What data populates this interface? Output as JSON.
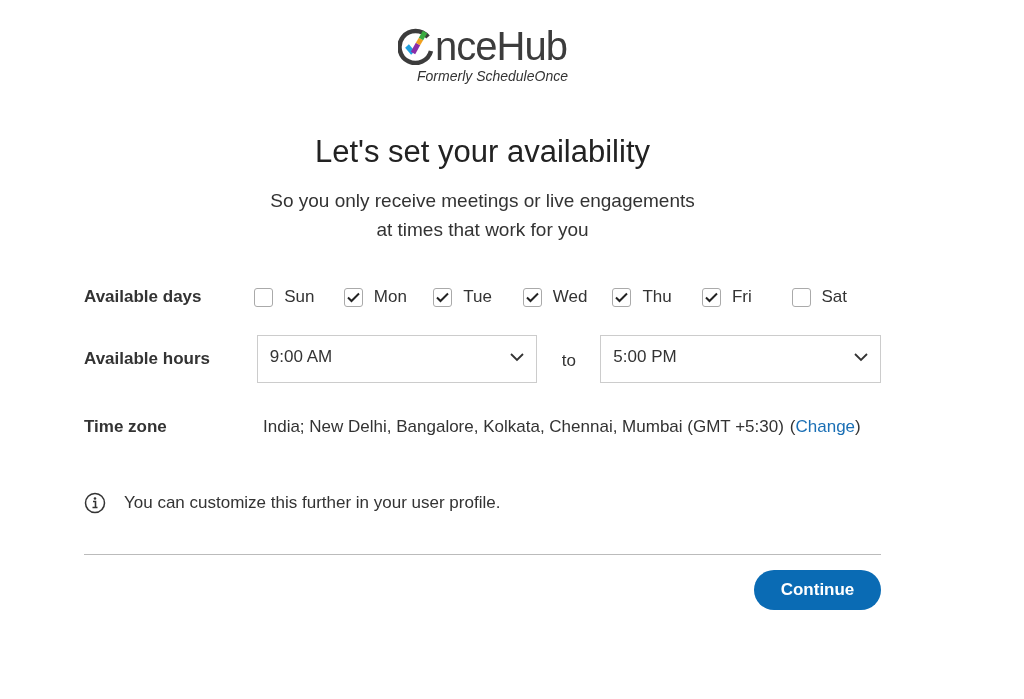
{
  "logo": {
    "name": "nceHub",
    "tagline": "Formerly ScheduleOnce"
  },
  "heading": "Let's set your availability",
  "subtitle": [
    "So you only receive meetings or live engagements",
    "at times that work for you"
  ],
  "days": {
    "label": "Available days",
    "items": [
      {
        "label": "Sun",
        "checked": false
      },
      {
        "label": "Mon",
        "checked": true
      },
      {
        "label": "Tue",
        "checked": true
      },
      {
        "label": "Wed",
        "checked": true
      },
      {
        "label": "Thu",
        "checked": true
      },
      {
        "label": "Fri",
        "checked": true
      },
      {
        "label": "Sat",
        "checked": false
      }
    ]
  },
  "hours": {
    "label": "Available hours",
    "from": "9:00 AM",
    "separator": "to",
    "to": "5:00 PM"
  },
  "timezone": {
    "label": "Time zone",
    "value": "India; New Delhi, Bangalore, Kolkata, Chennai, Mumbai (GMT +5:30)",
    "open_paren": "(",
    "link": "Change",
    "close_paren": ")"
  },
  "info": "You can customize this further in your user profile.",
  "continue_button": "Continue"
}
